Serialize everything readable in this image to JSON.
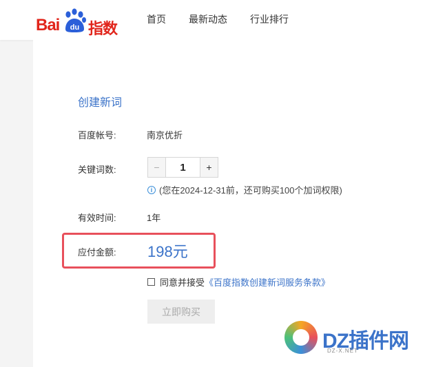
{
  "header": {
    "logo_bai": "Bai",
    "logo_du": "du",
    "logo_zhishu": "指数",
    "nav": [
      "首页",
      "最新动态",
      "行业排行"
    ]
  },
  "form": {
    "title": "创建新词",
    "account_label": "百度帐号:",
    "account_value": "南京优折",
    "keywords_label": "关键词数:",
    "stepper": {
      "minus": "−",
      "value": "1",
      "plus": "+"
    },
    "hint": "(您在2024-12-31前，还可购买100个加词权限)",
    "duration_label": "有效时间:",
    "duration_value": "1年",
    "amount_label": "应付金额:",
    "amount_value": "198元",
    "agree_text": "同意并接受",
    "agree_link": "《百度指数创建新词服务条款》",
    "buy_button": "立即购买"
  },
  "watermark": {
    "brand": "DZ插件网",
    "sub": "DZ-X.NET"
  },
  "colors": {
    "brand_red": "#e1251b",
    "link_blue": "#3b73c9",
    "highlight_border": "#e8505b"
  }
}
